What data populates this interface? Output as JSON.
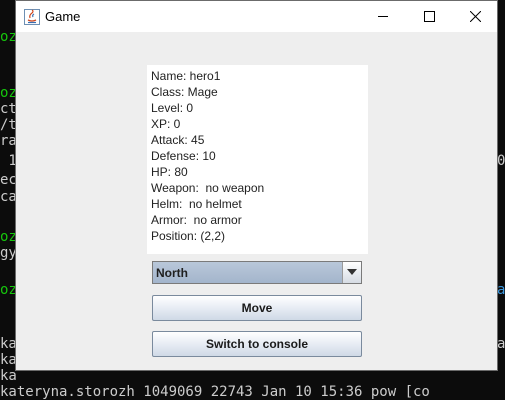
{
  "window": {
    "title": "Game",
    "controls": {
      "minimize": "minimize",
      "maximize": "maximize",
      "close": "close"
    }
  },
  "hero": {
    "lines": [
      "Name: hero1",
      "Class: Mage",
      "Level: 0",
      "XP: 0",
      "Attack: 45",
      "Defense: 10",
      "HP: 80",
      "Weapon:  no weapon",
      "Helm:  no helmet",
      "Armor:  no armor",
      "Position: (2,2)"
    ]
  },
  "direction_select": {
    "selected": "North"
  },
  "buttons": {
    "move": "Move",
    "switch": "Switch to console"
  },
  "console": {
    "bottom_line": "kateryna.storozh 1049069 22743 Jan 10 15:36 pow [co"
  }
}
